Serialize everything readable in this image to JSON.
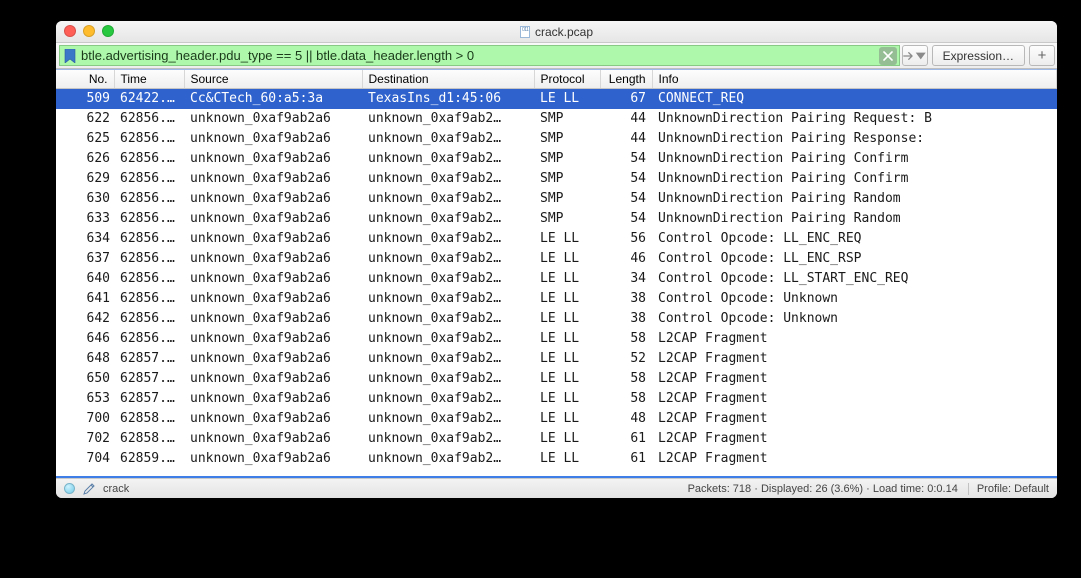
{
  "window": {
    "title": "crack.pcap"
  },
  "filter": {
    "expression_text": "btle.advertising_header.pdu_type == 5 || btle.data_header.length > 0",
    "expression_button": "Expression…",
    "plus_button": "+"
  },
  "columns": {
    "no": "No.",
    "time": "Time",
    "src": "Source",
    "dst": "Destination",
    "proto": "Protocol",
    "len": "Length",
    "info": "Info"
  },
  "packets": [
    {
      "no": "509",
      "time": "62422.…",
      "src": "Cc&CTech_60:a5:3a",
      "dst": "TexasIns_d1:45:06",
      "proto": "LE LL",
      "len": "67",
      "info": "CONNECT_REQ",
      "selected": true
    },
    {
      "no": "622",
      "time": "62856.…",
      "src": "unknown_0xaf9ab2a6",
      "dst": "unknown_0xaf9ab2…",
      "proto": "SMP",
      "len": "44",
      "info": "UnknownDirection Pairing Request: B"
    },
    {
      "no": "625",
      "time": "62856.…",
      "src": "unknown_0xaf9ab2a6",
      "dst": "unknown_0xaf9ab2…",
      "proto": "SMP",
      "len": "44",
      "info": "UnknownDirection Pairing Response:"
    },
    {
      "no": "626",
      "time": "62856.…",
      "src": "unknown_0xaf9ab2a6",
      "dst": "unknown_0xaf9ab2…",
      "proto": "SMP",
      "len": "54",
      "info": "UnknownDirection Pairing Confirm"
    },
    {
      "no": "629",
      "time": "62856.…",
      "src": "unknown_0xaf9ab2a6",
      "dst": "unknown_0xaf9ab2…",
      "proto": "SMP",
      "len": "54",
      "info": "UnknownDirection Pairing Confirm"
    },
    {
      "no": "630",
      "time": "62856.…",
      "src": "unknown_0xaf9ab2a6",
      "dst": "unknown_0xaf9ab2…",
      "proto": "SMP",
      "len": "54",
      "info": "UnknownDirection Pairing Random"
    },
    {
      "no": "633",
      "time": "62856.…",
      "src": "unknown_0xaf9ab2a6",
      "dst": "unknown_0xaf9ab2…",
      "proto": "SMP",
      "len": "54",
      "info": "UnknownDirection Pairing Random"
    },
    {
      "no": "634",
      "time": "62856.…",
      "src": "unknown_0xaf9ab2a6",
      "dst": "unknown_0xaf9ab2…",
      "proto": "LE LL",
      "len": "56",
      "info": "Control Opcode: LL_ENC_REQ"
    },
    {
      "no": "637",
      "time": "62856.…",
      "src": "unknown_0xaf9ab2a6",
      "dst": "unknown_0xaf9ab2…",
      "proto": "LE LL",
      "len": "46",
      "info": "Control Opcode: LL_ENC_RSP"
    },
    {
      "no": "640",
      "time": "62856.…",
      "src": "unknown_0xaf9ab2a6",
      "dst": "unknown_0xaf9ab2…",
      "proto": "LE LL",
      "len": "34",
      "info": "Control Opcode: LL_START_ENC_REQ"
    },
    {
      "no": "641",
      "time": "62856.…",
      "src": "unknown_0xaf9ab2a6",
      "dst": "unknown_0xaf9ab2…",
      "proto": "LE LL",
      "len": "38",
      "info": "Control Opcode: Unknown"
    },
    {
      "no": "642",
      "time": "62856.…",
      "src": "unknown_0xaf9ab2a6",
      "dst": "unknown_0xaf9ab2…",
      "proto": "LE LL",
      "len": "38",
      "info": "Control Opcode: Unknown"
    },
    {
      "no": "646",
      "time": "62856.…",
      "src": "unknown_0xaf9ab2a6",
      "dst": "unknown_0xaf9ab2…",
      "proto": "LE LL",
      "len": "58",
      "info": "L2CAP Fragment"
    },
    {
      "no": "648",
      "time": "62857.…",
      "src": "unknown_0xaf9ab2a6",
      "dst": "unknown_0xaf9ab2…",
      "proto": "LE LL",
      "len": "52",
      "info": "L2CAP Fragment"
    },
    {
      "no": "650",
      "time": "62857.…",
      "src": "unknown_0xaf9ab2a6",
      "dst": "unknown_0xaf9ab2…",
      "proto": "LE LL",
      "len": "58",
      "info": "L2CAP Fragment"
    },
    {
      "no": "653",
      "time": "62857.…",
      "src": "unknown_0xaf9ab2a6",
      "dst": "unknown_0xaf9ab2…",
      "proto": "LE LL",
      "len": "58",
      "info": "L2CAP Fragment"
    },
    {
      "no": "700",
      "time": "62858.…",
      "src": "unknown_0xaf9ab2a6",
      "dst": "unknown_0xaf9ab2…",
      "proto": "LE LL",
      "len": "48",
      "info": "L2CAP Fragment"
    },
    {
      "no": "702",
      "time": "62858.…",
      "src": "unknown_0xaf9ab2a6",
      "dst": "unknown_0xaf9ab2…",
      "proto": "LE LL",
      "len": "61",
      "info": "L2CAP Fragment"
    },
    {
      "no": "704",
      "time": "62859.…",
      "src": "unknown_0xaf9ab2a6",
      "dst": "unknown_0xaf9ab2…",
      "proto": "LE LL",
      "len": "61",
      "info": "L2CAP Fragment"
    }
  ],
  "status": {
    "file": "crack",
    "packets": "Packets: 718",
    "displayed": "Displayed: 26 (3.6%)",
    "load": "Load time: 0:0.14",
    "profile": "Profile: Default"
  }
}
